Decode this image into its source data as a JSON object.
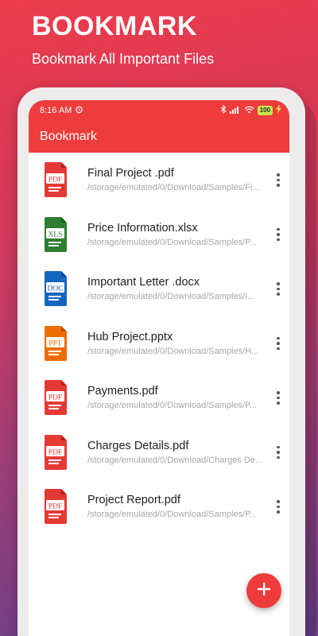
{
  "promo": {
    "title": "BOOKMARK",
    "subtitle": "Bookmark All Important Files"
  },
  "status_bar": {
    "time": "8:16 AM",
    "alarm_icon": "alarm-icon",
    "battery": "100",
    "icons": [
      "bluetooth-icon",
      "signal-icon",
      "wifi-icon",
      "battery-icon",
      "charging-icon"
    ]
  },
  "app_bar": {
    "title": "Bookmark"
  },
  "colors": {
    "accent": "#ee3c3c",
    "pdf": "#e53935",
    "xlsx": "#2e7d32",
    "docx": "#1565c0",
    "pptx": "#ef6c00"
  },
  "files": [
    {
      "name": "Final Project .pdf",
      "path": "/storage/emulated/0/Download/Samples/Fi...",
      "type": "PDF"
    },
    {
      "name": "Price Information.xlsx",
      "path": "/storage/emulated/0/Download/Samples/P...",
      "type": "XLS"
    },
    {
      "name": "Important Letter .docx",
      "path": "/storage/emulated/0/Download/Samples/I...",
      "type": "DOC"
    },
    {
      "name": "Hub Project.pptx",
      "path": "/storage/emulated/0/Download/Samples/H...",
      "type": "PPT"
    },
    {
      "name": "Payments.pdf",
      "path": "/storage/emulated/0/Download/Samples/P...",
      "type": "PDF"
    },
    {
      "name": "Charges Details.pdf",
      "path": "/storage/emulated/0/Download/Charges De...",
      "type": "PDF"
    },
    {
      "name": "Project Report.pdf",
      "path": "/storage/emulated/0/Download/Samples/P...",
      "type": "PDF"
    }
  ],
  "fab": {
    "icon": "plus-icon"
  }
}
